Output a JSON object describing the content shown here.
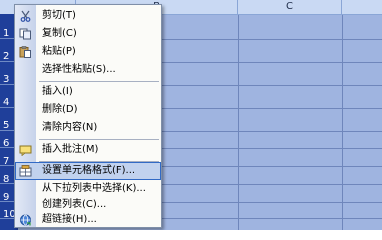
{
  "spreadsheet": {
    "columns": [
      "B",
      "C"
    ],
    "rows": [
      "1",
      "2",
      "3",
      "4",
      "5",
      "6",
      "7",
      "8",
      "9",
      "10"
    ]
  },
  "menu": {
    "items": [
      {
        "label": "剪切(T)",
        "icon": "scissors-icon"
      },
      {
        "label": "复制(C)",
        "icon": "copy-icon"
      },
      {
        "label": "粘贴(P)",
        "icon": "paste-icon"
      },
      {
        "label": "选择性粘贴(S)..."
      },
      {
        "label": "插入(I)"
      },
      {
        "label": "删除(D)"
      },
      {
        "label": "清除内容(N)"
      },
      {
        "label": "插入批注(M)",
        "icon": "comment-icon"
      },
      {
        "label": "设置单元格格式(F)...",
        "icon": "format-cells-icon"
      },
      {
        "label": "从下拉列表中选择(K)..."
      },
      {
        "label": "创建列表(C)..."
      },
      {
        "label": "超链接(H)...",
        "icon": "hyperlink-icon"
      }
    ]
  },
  "colors": {
    "selection": "#9fb4e0",
    "row_header": "#1f3f9a",
    "menu_hover": "#c1d2ee",
    "menu_hover_border": "#316ac5"
  }
}
